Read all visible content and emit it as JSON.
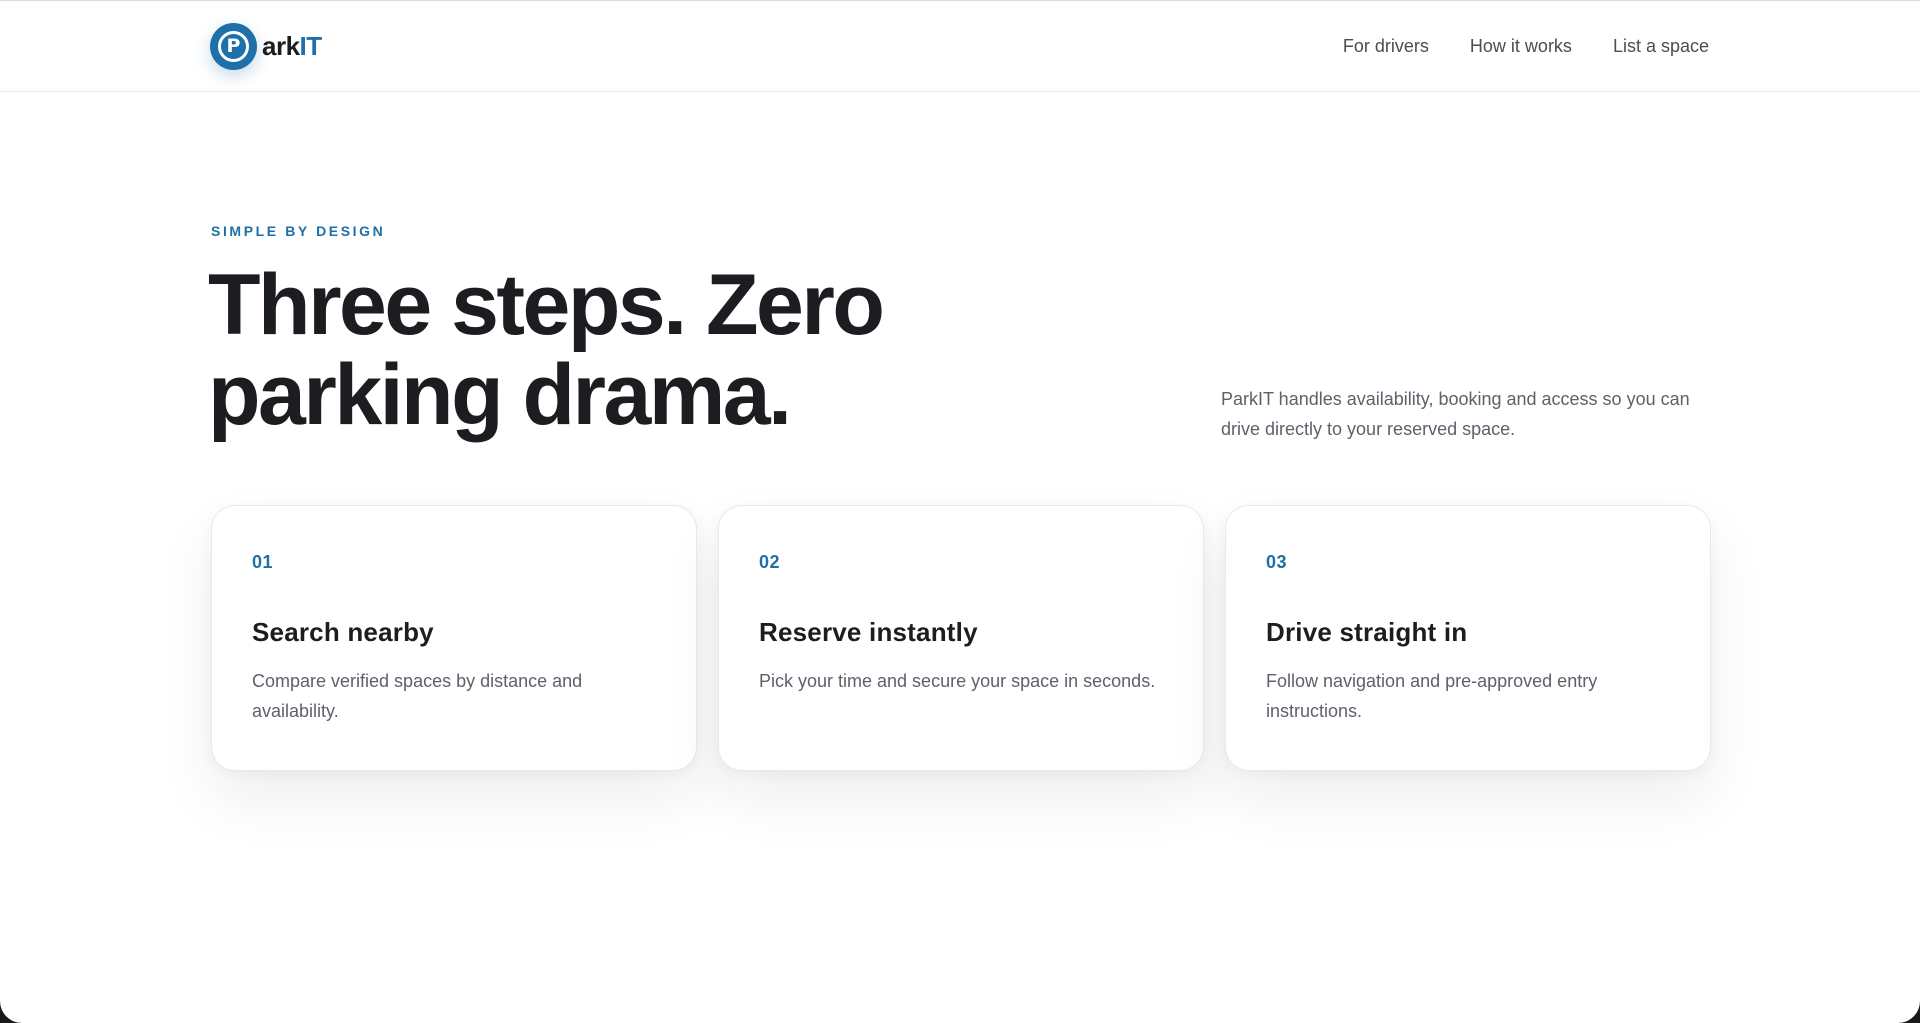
{
  "brand": {
    "mark_letter": "P",
    "name_dark": "ark",
    "name_accent": "IT",
    "accent_color": "#1f6fa8",
    "text_color": "#1c1d21"
  },
  "nav": {
    "items": [
      {
        "label": "For drivers"
      },
      {
        "label": "How it works"
      },
      {
        "label": "List a space"
      }
    ]
  },
  "hero": {
    "eyebrow": "SIMPLE BY DESIGN",
    "title_line1": "Three steps. Zero",
    "title_line2": "parking drama.",
    "lead": "ParkIT handles availability, booking and access so you can drive directly to your reserved space."
  },
  "steps": [
    {
      "number": "01",
      "title": "Search nearby",
      "description": "Compare verified spaces by distance and availability."
    },
    {
      "number": "02",
      "title": "Reserve instantly",
      "description": "Pick your time and secure your space in seconds."
    },
    {
      "number": "03",
      "title": "Drive straight in",
      "description": "Follow navigation and pre-approved entry instructions."
    }
  ]
}
